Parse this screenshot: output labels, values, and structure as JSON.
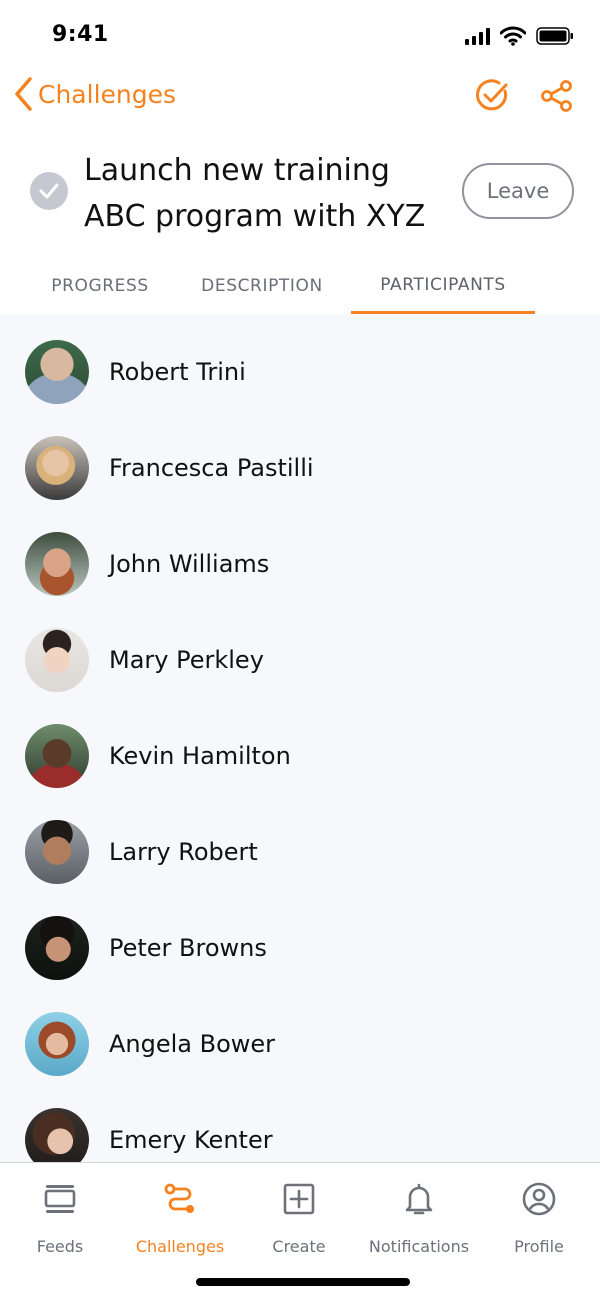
{
  "status_bar": {
    "time": "9:41"
  },
  "nav": {
    "back_label": "Challenges",
    "actions": [
      "check-circle-icon",
      "share-icon"
    ]
  },
  "challenge": {
    "title": "Launch new training ABC program with XYZ",
    "leave_label": "Leave"
  },
  "tabs": [
    {
      "label": "PROGRESS",
      "active": false
    },
    {
      "label": "DESCRIPTION",
      "active": false
    },
    {
      "label": "PARTICIPANTS",
      "active": true
    }
  ],
  "participants": [
    {
      "name": "Robert Trini"
    },
    {
      "name": "Francesca Pastilli"
    },
    {
      "name": "John Williams"
    },
    {
      "name": "Mary Perkley"
    },
    {
      "name": "Kevin Hamilton"
    },
    {
      "name": "Larry Robert"
    },
    {
      "name": "Peter Browns"
    },
    {
      "name": "Angela Bower"
    },
    {
      "name": "Emery Kenter"
    }
  ],
  "bottom_nav": [
    {
      "label": "Feeds",
      "icon": "feeds-icon",
      "active": false
    },
    {
      "label": "Challenges",
      "icon": "challenges-icon",
      "active": true
    },
    {
      "label": "Create",
      "icon": "create-icon",
      "active": false
    },
    {
      "label": "Notifications",
      "icon": "bell-icon",
      "active": false
    },
    {
      "label": "Profile",
      "icon": "profile-icon",
      "active": false
    }
  ],
  "colors": {
    "accent": "#f5821f",
    "list_background": "#f7f8fc",
    "inactive_text": "#6d7179"
  }
}
